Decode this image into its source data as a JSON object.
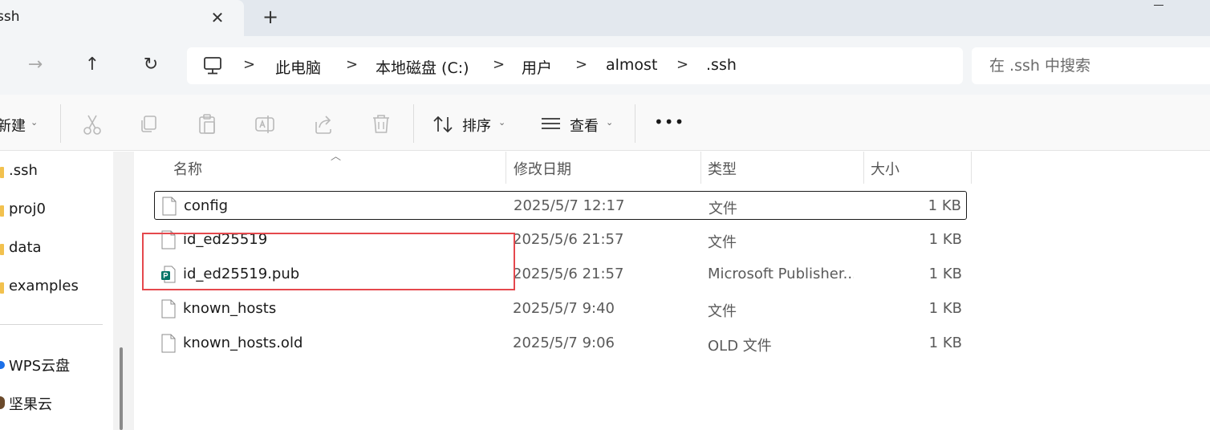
{
  "tab": {
    "title": "ssh",
    "close_glyph": "✕",
    "new_tab_glyph": "+"
  },
  "nav": {
    "forward_glyph": "→",
    "up_glyph": "↑",
    "refresh_glyph": "↻",
    "breadcrumbs": [
      "此电脑",
      "本地磁盘 (C:)",
      "用户",
      "almost",
      ".ssh"
    ],
    "separator_glyph": ">",
    "search_placeholder": "在 .ssh 中搜索"
  },
  "toolbar": {
    "new_label": "新建",
    "sort_label": "排序",
    "view_label": "查看",
    "more_glyph": "•••",
    "caret_glyph": "⌄",
    "icons": [
      "cut-icon",
      "copy-icon",
      "paste-icon",
      "rename-icon",
      "share-icon",
      "delete-icon"
    ]
  },
  "sidebar": {
    "items": [
      ".ssh",
      "proj0",
      "data",
      "examples",
      "WPS云盘",
      "坚果云"
    ],
    "folder_color": "#f2c14e"
  },
  "columns": {
    "name": "名称",
    "date": "修改日期",
    "type": "类型",
    "size": "大小"
  },
  "files": [
    {
      "name": "config",
      "date": "2025/5/7 12:17",
      "type": "文件",
      "size": "1 KB",
      "selected": true,
      "icon": "file-icon"
    },
    {
      "name": "id_ed25519",
      "date": "2025/5/6 21:57",
      "type": "文件",
      "size": "1 KB",
      "selected": false,
      "icon": "file-icon"
    },
    {
      "name": "id_ed25519.pub",
      "date": "2025/5/6 21:57",
      "type": "Microsoft Publisher...",
      "size": "1 KB",
      "selected": false,
      "icon": "publisher-icon"
    },
    {
      "name": "known_hosts",
      "date": "2025/5/7 9:40",
      "type": "文件",
      "size": "1 KB",
      "selected": false,
      "icon": "file-icon"
    },
    {
      "name": "known_hosts.old",
      "date": "2025/5/7 9:06",
      "type": "OLD 文件",
      "size": "1 KB",
      "selected": false,
      "icon": "file-icon"
    }
  ],
  "colors": {
    "annotation": "#e5484d",
    "publisher": "#077568"
  }
}
